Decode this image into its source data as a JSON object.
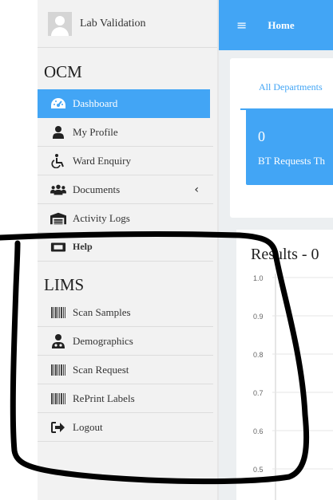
{
  "user": {
    "name": "Lab Validation"
  },
  "sections": {
    "ocm": "OCM",
    "lims": "LIMS"
  },
  "ocm_menu": [
    {
      "label": "Dashboard",
      "icon": "dashboard-icon",
      "active": true
    },
    {
      "label": "My Profile",
      "icon": "user-icon"
    },
    {
      "label": "Ward Enquiry",
      "icon": "wheelchair-icon"
    },
    {
      "label": "Documents",
      "icon": "users-icon",
      "chevron": "chevron-left-icon"
    },
    {
      "label": "Activity Logs",
      "icon": "warehouse-icon"
    },
    {
      "label": "Help",
      "icon": "ticket-icon"
    }
  ],
  "lims_menu": [
    {
      "label": "Scan Samples",
      "icon": "barcode-icon"
    },
    {
      "label": "Demographics",
      "icon": "user-doctor-icon"
    },
    {
      "label": "Scan Request",
      "icon": "barcode-icon"
    },
    {
      "label": "RePrint Labels",
      "icon": "barcode-icon"
    },
    {
      "label": "Logout",
      "icon": "sign-out-icon"
    }
  ],
  "topbar": {
    "menu_icon": "hamburger-icon",
    "title": "Home"
  },
  "tabs": {
    "active": "All Departments"
  },
  "card": {
    "count": "0",
    "label": "BT Requests Th"
  },
  "chart_data": {
    "type": "bar",
    "title": "Results - 0",
    "categories": [],
    "values": [],
    "yticks": [
      "1.0",
      "0.9",
      "0.8",
      "0.7",
      "0.6",
      "0.5"
    ],
    "ylim": [
      0,
      1
    ],
    "grid": true
  },
  "colors": {
    "accent": "#42a5f5",
    "sidebar": "#f2f2f2",
    "content_bg": "#eceff1",
    "annotation": "#000000"
  }
}
